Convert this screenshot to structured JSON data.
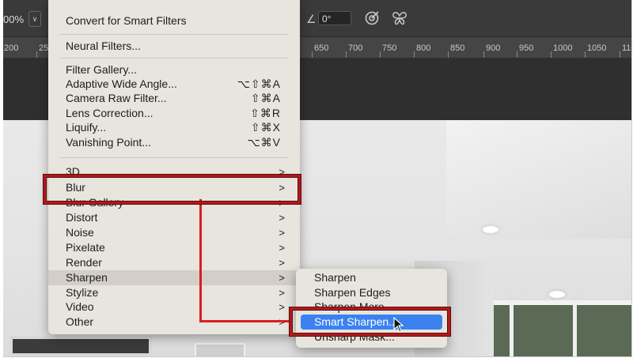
{
  "options_bar": {
    "zoom_value": "00%",
    "angle_value": "0°",
    "icons": [
      "angle-icon",
      "target-icon",
      "butterfly-icon"
    ]
  },
  "ruler": {
    "ticks": [
      "200",
      "25",
      "650",
      "700",
      "750",
      "800",
      "850",
      "900",
      "950",
      "1000",
      "1050",
      "110"
    ]
  },
  "filter_menu": {
    "items": [
      {
        "label": "Convert for Smart Filters",
        "shortcut": "",
        "submenu": false
      },
      {
        "label": "Neural Filters...",
        "shortcut": "",
        "submenu": false
      },
      {
        "label": "Filter Gallery...",
        "shortcut": "",
        "submenu": false
      },
      {
        "label": "Adaptive Wide Angle...",
        "shortcut": "⌥⇧⌘A",
        "submenu": false
      },
      {
        "label": "Camera Raw Filter...",
        "shortcut": "⇧⌘A",
        "submenu": false
      },
      {
        "label": "Lens Correction...",
        "shortcut": "⇧⌘R",
        "submenu": false
      },
      {
        "label": "Liquify...",
        "shortcut": "⇧⌘X",
        "submenu": false
      },
      {
        "label": "Vanishing Point...",
        "shortcut": "⌥⌘V",
        "submenu": false
      },
      {
        "label": "3D",
        "shortcut": "",
        "submenu": true
      },
      {
        "label": "Blur",
        "shortcut": "",
        "submenu": true
      },
      {
        "label": "Blur Gallery",
        "shortcut": "",
        "submenu": true
      },
      {
        "label": "Distort",
        "shortcut": "",
        "submenu": true
      },
      {
        "label": "Noise",
        "shortcut": "",
        "submenu": true
      },
      {
        "label": "Pixelate",
        "shortcut": "",
        "submenu": true
      },
      {
        "label": "Render",
        "shortcut": "",
        "submenu": true
      },
      {
        "label": "Sharpen",
        "shortcut": "",
        "submenu": true
      },
      {
        "label": "Stylize",
        "shortcut": "",
        "submenu": true
      },
      {
        "label": "Video",
        "shortcut": "",
        "submenu": true
      },
      {
        "label": "Other",
        "shortcut": "",
        "submenu": true
      }
    ],
    "chevron": ">"
  },
  "sharpen_submenu": {
    "items": [
      {
        "label": "Sharpen"
      },
      {
        "label": "Sharpen Edges"
      },
      {
        "label": "Sharpen More"
      },
      {
        "label": "Smart Sharpen..."
      },
      {
        "label": "Unsharp Mask..."
      }
    ],
    "selected": "Smart Sharpen..."
  },
  "colors": {
    "highlight_box": "#b3191b",
    "connector_line": "#d81e20",
    "selection": "#3b82f0",
    "menu_bg": "#e8e4de"
  }
}
